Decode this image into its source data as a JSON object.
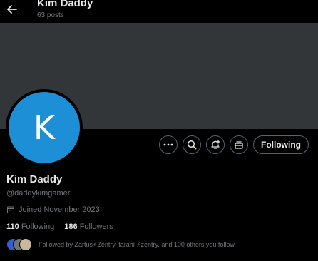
{
  "header": {
    "title": "Kim Daddy",
    "post_count": "63 posts"
  },
  "profile": {
    "avatar_letter": "K",
    "avatar_color": "#1d8fd6",
    "name": "Kim Daddy",
    "handle": "@daddykimgamer",
    "joined": "Joined November 2023",
    "following_count": "110",
    "following_label": "Following",
    "followers_count": "186",
    "followers_label": "Followers",
    "followed_by": "Followed by Zartus⚡Zentry, tarani ⚡zentry, and 100 others you follow"
  },
  "actions": {
    "following_button": "Following",
    "icons": [
      "more-icon",
      "search-icon",
      "notification-subscribe-icon",
      "subscribe-icon"
    ]
  },
  "colors": {
    "background": "#000000",
    "banner": "#333639",
    "text_primary": "#e7e9ea",
    "text_secondary": "#71767b",
    "button_border": "#536471"
  }
}
